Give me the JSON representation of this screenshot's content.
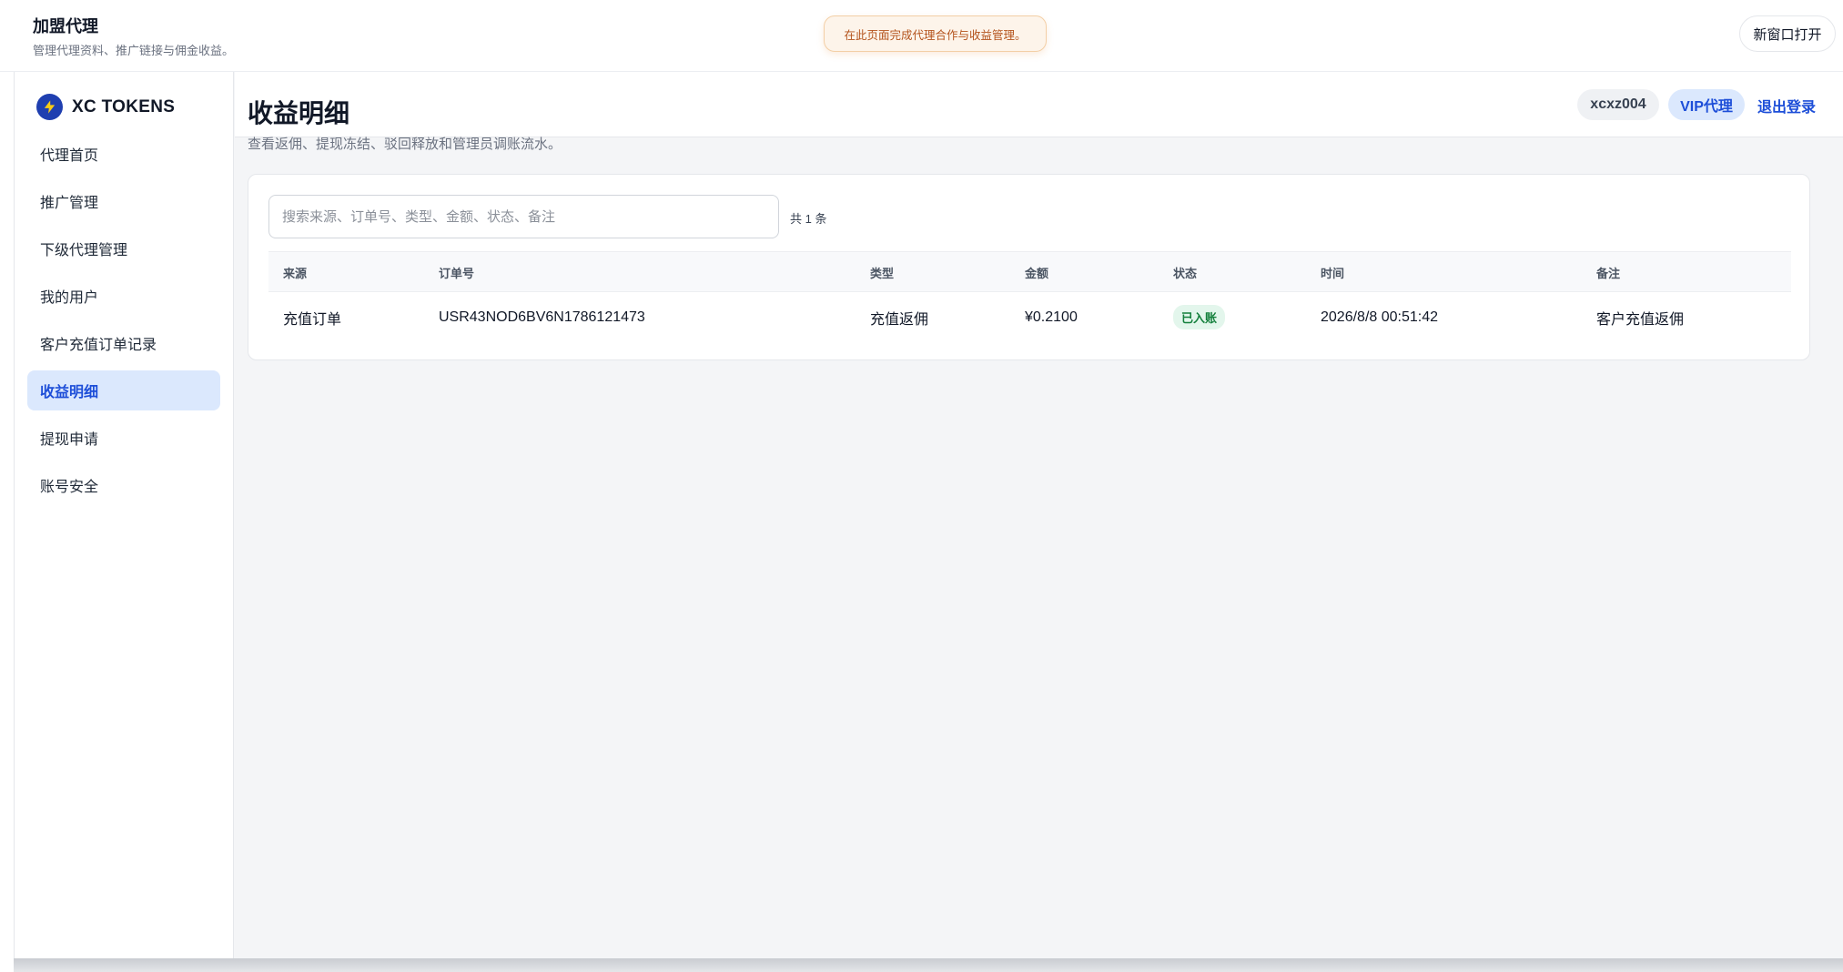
{
  "header": {
    "title": "加盟代理",
    "subtitle": "管理代理资料、推广链接与佣金收益。",
    "toast": "在此页面完成代理合作与收益管理。",
    "open_window": "新窗口打开"
  },
  "brand": {
    "name": "XC TOKENS",
    "icon": "lightning-bolt-icon"
  },
  "sidebar": {
    "items": [
      {
        "label": "代理首页",
        "active": false
      },
      {
        "label": "推广管理",
        "active": false
      },
      {
        "label": "下级代理管理",
        "active": false
      },
      {
        "label": "我的用户",
        "active": false
      },
      {
        "label": "客户充值订单记录",
        "active": false
      },
      {
        "label": "收益明细",
        "active": true
      },
      {
        "label": "提现申请",
        "active": false
      },
      {
        "label": "账号安全",
        "active": false
      }
    ]
  },
  "topbar": {
    "username": "xcxz004",
    "role": "VIP代理",
    "logout": "退出登录"
  },
  "main": {
    "title": "收益明细",
    "description": "查看返佣、提现冻结、驳回释放和管理员调账流水。",
    "search": {
      "placeholder": "搜索来源、订单号、类型、金额、状态、备注",
      "value": ""
    },
    "count": "共 1 条",
    "table": {
      "columns": [
        "来源",
        "订单号",
        "类型",
        "金额",
        "状态",
        "时间",
        "备注"
      ],
      "rows": [
        [
          "充值订单",
          "USR43NOD6BV6N1786121473",
          "充值返佣",
          "¥0.2100",
          "已入账",
          "2026/8/8 00:51:42",
          "客户充值返佣"
        ]
      ]
    }
  },
  "colors": {
    "accent": "#1d4ed8",
    "active_bg": "#dbe8fd",
    "status_green": "#15803d",
    "toast_text": "#b4531c"
  }
}
